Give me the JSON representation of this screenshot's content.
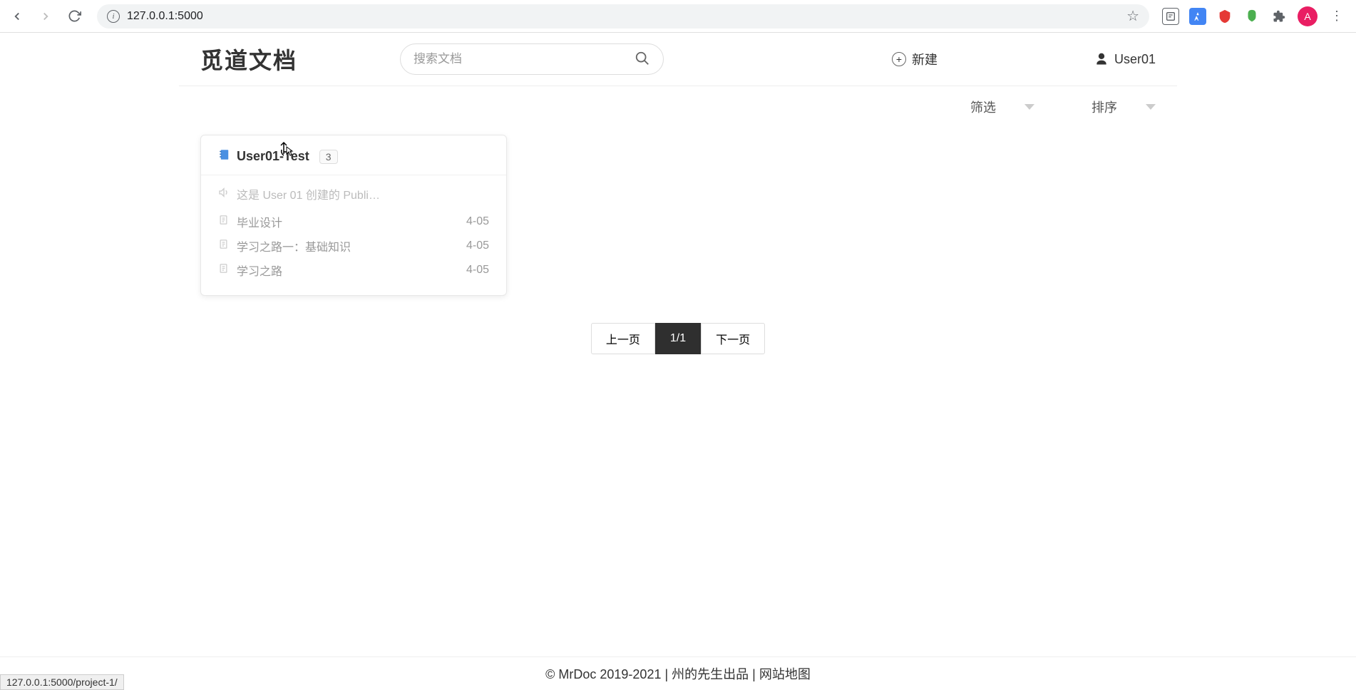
{
  "browser": {
    "url": "127.0.0.1:5000",
    "status_link": "127.0.0.1:5000/project-1/",
    "avatar_letter": "A"
  },
  "header": {
    "logo": "觅道文档",
    "search_placeholder": "搜索文档",
    "new_label": "新建",
    "username": "User01"
  },
  "filters": {
    "filter_label": "筛选",
    "sort_label": "排序"
  },
  "project": {
    "title": "User01-Test",
    "count": "3",
    "description": "这是 User 01 创建的 Publi…",
    "docs": [
      {
        "name": "毕业设计",
        "date": "4-05"
      },
      {
        "name": "学习之路一：基础知识",
        "date": "4-05"
      },
      {
        "name": "学习之路",
        "date": "4-05"
      }
    ]
  },
  "pagination": {
    "prev": "上一页",
    "current": "1/1",
    "next": "下一页"
  },
  "footer": {
    "copyright": "© MrDoc 2019-2021 | ",
    "author": "州的先生出品",
    "sep": " | ",
    "sitemap": "网站地图"
  }
}
